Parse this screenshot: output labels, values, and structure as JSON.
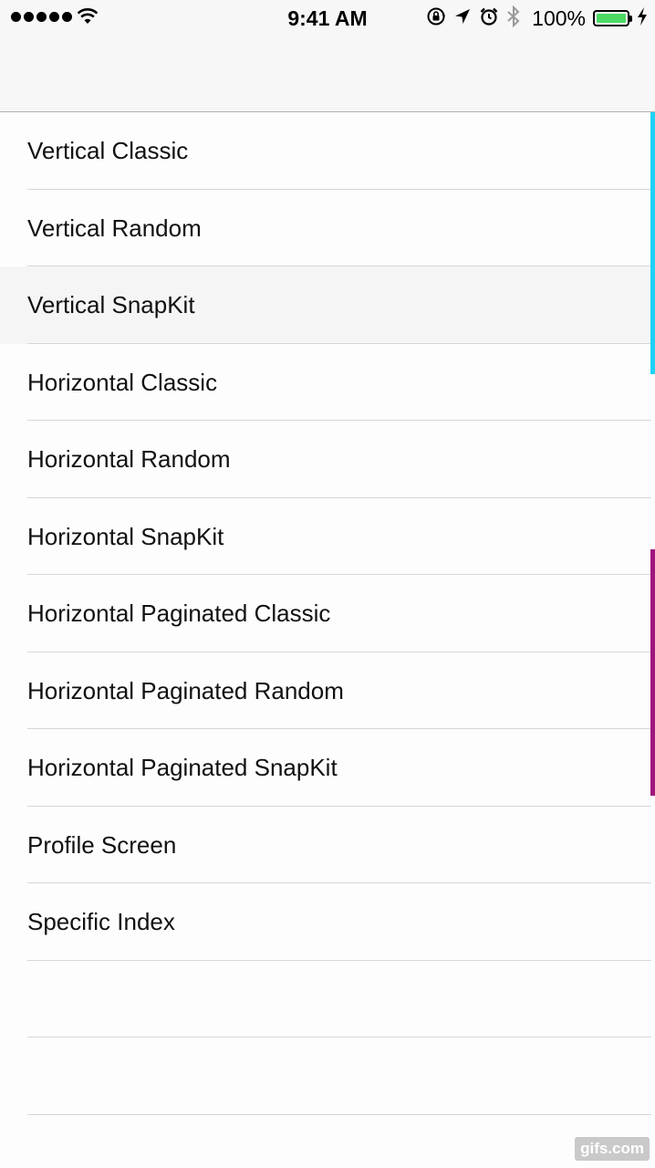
{
  "status_bar": {
    "time": "9:41 AM",
    "battery_percent": "100%",
    "battery_level": 1.0,
    "battery_color": "#4cd964",
    "icons": [
      "signal-dots-icon",
      "wifi-icon",
      "orientation-lock-icon",
      "location-arrow-icon",
      "alarm-icon",
      "bluetooth-icon",
      "battery-icon",
      "charging-bolt-icon"
    ]
  },
  "list": {
    "items": [
      {
        "label": "Vertical Classic"
      },
      {
        "label": "Vertical Random"
      },
      {
        "label": "Vertical SnapKit"
      },
      {
        "label": "Horizontal Classic"
      },
      {
        "label": "Horizontal Random"
      },
      {
        "label": "Horizontal SnapKit"
      },
      {
        "label": "Horizontal Paginated Classic"
      },
      {
        "label": "Horizontal Paginated Random"
      },
      {
        "label": "Horizontal Paginated SnapKit"
      },
      {
        "label": "Profile Screen"
      },
      {
        "label": "Specific Index"
      }
    ],
    "highlighted_index": 2
  },
  "accents": {
    "cyan": "#1ed1f5",
    "purple": "#a0167e"
  },
  "watermark": {
    "text": "gifs.com"
  }
}
